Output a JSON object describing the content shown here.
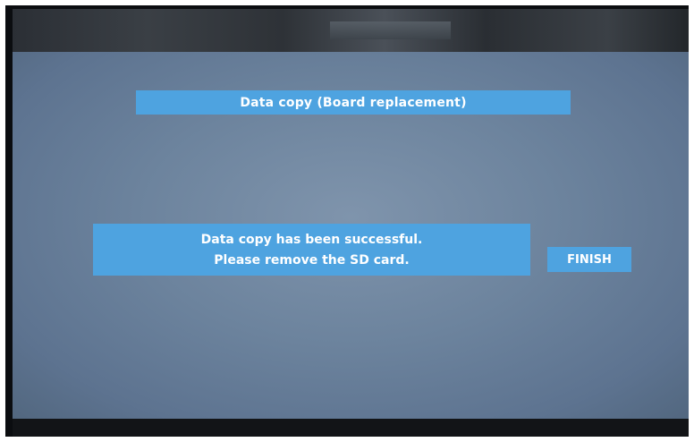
{
  "screen": {
    "title": "Data copy (Board replacement)",
    "message": {
      "line1": "Data copy has been successful.",
      "line2": "Please remove the SD card."
    },
    "finish_label": "FINISH"
  },
  "colors": {
    "banner": "#4ea3e0",
    "screen_background": "#6c839d",
    "bezel": "#0b0d10",
    "text": "#ffffff"
  }
}
